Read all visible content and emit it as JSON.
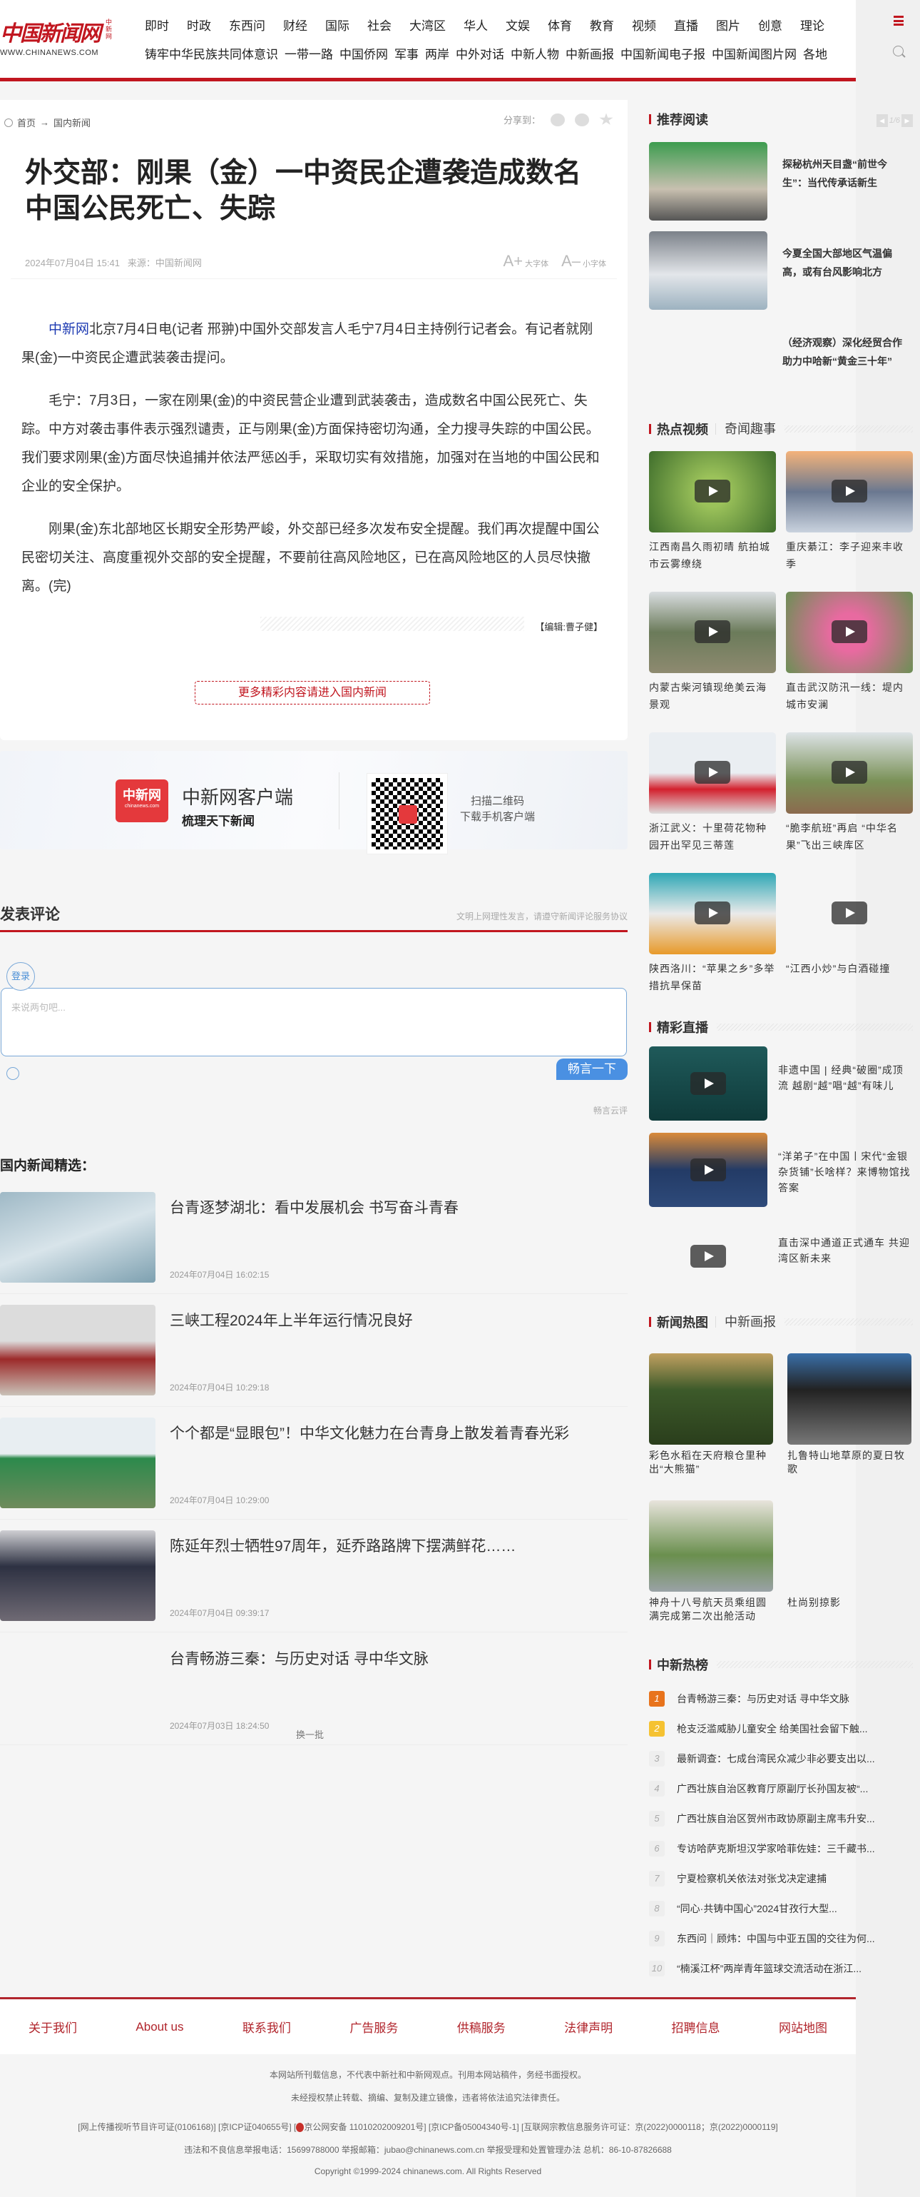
{
  "header": {
    "logo_text": "中国新闻网",
    "logo_side": "中新网",
    "logo_url": "WWW.CHINANEWS.COM",
    "nav_primary": [
      "即时",
      "时政",
      "东西问",
      "财经",
      "国际",
      "社会",
      "大湾区",
      "华人",
      "文娱",
      "体育",
      "教育",
      "视频",
      "直播",
      "图片",
      "创意",
      "理论"
    ],
    "nav_secondary": [
      "铸牢中华民族共同体意识",
      "一带一路",
      "中国侨网",
      "军事",
      "两岸",
      "中外对话",
      "中新人物",
      "中新画报",
      "中国新闻电子报",
      "中国新闻图片网",
      "各地"
    ],
    "accent_color": "#c1161f"
  },
  "breadcrumb": {
    "home": "首页",
    "arrow": "→",
    "section": "国内新闻"
  },
  "share": {
    "label": "分享到："
  },
  "article": {
    "title": "外交部：刚果（金）一中资民企遭袭造成数名中国公民死亡、失踪",
    "date": "2024年07月04日 15:41",
    "source": "来源：中国新闻网",
    "font_large": "大字体",
    "font_small": "小字体",
    "lead_link": "中新网",
    "paragraphs": [
      "北京7月4日电(记者 邢翀)中国外交部发言人毛宁7月4日主持例行记者会。有记者就刚果(金)一中资民企遭武装袭击提问。",
      "毛宁：7月3日，一家在刚果(金)的中资民营企业遭到武装袭击，造成数名中国公民死亡、失踪。中方对袭击事件表示强烈谴责，正与刚果(金)方面保持密切沟通，全力搜寻失踪的中国公民。我们要求刚果(金)方面尽快追捕并依法严惩凶手，采取切实有效措施，加强对在当地的中国公民和企业的安全保护。",
      "刚果(金)东北部地区长期安全形势严峻，外交部已经多次发布安全提醒。我们再次提醒中国公民密切关注、高度重视外交部的安全提醒，不要前往高风险地区，已在高风险地区的人员尽快撤离。(完)"
    ],
    "editor": "【编辑:曹子健】",
    "more_button": "更多精彩内容请进入国内新闻"
  },
  "app_banner": {
    "logo_text": "中新网",
    "logo_url": "chinanews.com",
    "name": "中新网客户端",
    "slogan": "梳理天下新闻",
    "scan_line1": "扫描二维码",
    "scan_line2": "下载手机客户端"
  },
  "comments": {
    "title": "发表评论",
    "note": "文明上网理性发言，请遵守新闻评论服务协议",
    "login": "登录",
    "placeholder": "来说两句吧...",
    "submit": "畅言一下",
    "provider": "畅言云评"
  },
  "selection": {
    "title": "国内新闻精选：",
    "items": [
      {
        "title": "台青逐梦湖北：看中发展机会 书写奋斗青春",
        "time": "2024年07月04日 16:02:15"
      },
      {
        "title": "三峡工程2024年上半年运行情况良好",
        "time": "2024年07月04日 10:29:18"
      },
      {
        "title": "个个都是“显眼包”！中华文化魅力在台青身上散发着青春光彩",
        "time": "2024年07月04日 10:29:00"
      },
      {
        "title": "陈延年烈士牺牲97周年，延乔路路牌下摆满鲜花……",
        "time": "2024年07月04日 09:39:17"
      },
      {
        "title": "台青畅游三秦：与历史对话 寻中华文脉",
        "time": "2024年07月03日 18:24:50"
      }
    ],
    "swap": "换一批"
  },
  "sidebar": {
    "recommend": {
      "title": "推荐阅读",
      "pager": "1/6",
      "items": [
        {
          "title": "探秘杭州天目盏“前世今生”：当代传承话新生"
        },
        {
          "title": "今夏全国大部地区气温偏高，或有台风影响北方"
        },
        {
          "title": "（经济观察）深化经贸合作助力中哈新“黄金三十年”"
        }
      ]
    },
    "videos": {
      "title": "热点视频",
      "alt_tab": "奇闻趣事",
      "items": [
        {
          "title": "江西南昌久雨初晴 航拍城市云雾缭绕"
        },
        {
          "title": "重庆綦江：李子迎来丰收季"
        },
        {
          "title": "内蒙古柴河镇现绝美云海景观"
        },
        {
          "title": "直击武汉防汛一线：堤内城市安澜"
        },
        {
          "title": "浙江武义：十里荷花物种园开出罕见三蒂莲"
        },
        {
          "title": "“脆李航班”再启 “中华名果”飞出三峡库区"
        },
        {
          "title": "陕西洛川：“苹果之乡”多举措抗旱保苗"
        },
        {
          "title": "“江西小炒”与白酒碰撞"
        }
      ]
    },
    "live": {
      "title": "精彩直播",
      "items": [
        {
          "title": "非遗中国 | 经典“破圈”成顶流 越剧“越”唱“越”有味儿"
        },
        {
          "title": "“洋弟子”在中国丨宋代“金银杂货铺”长啥样？来博物馆找答案"
        },
        {
          "title": "直击深中通道正式通车 共迎湾区新未来"
        }
      ]
    },
    "photos": {
      "title": "新闻热图",
      "alt_tab": "中新画报",
      "items": [
        {
          "title": "彩色水稻在天府粮仓里种出“大熊猫”"
        },
        {
          "title": "扎鲁特山地草原的夏日牧歌"
        },
        {
          "title": "神舟十八号航天员乘组圆满完成第二次出舱活动"
        },
        {
          "title": "杜尚别掠影"
        }
      ]
    },
    "hot": {
      "title": "中新热榜",
      "items": [
        {
          "rank": "1",
          "title": "台青畅游三秦：与历史对话 寻中华文脉"
        },
        {
          "rank": "2",
          "title": "枪支泛滥威胁儿童安全 给美国社会留下触..."
        },
        {
          "rank": "3",
          "title": "最新调查：七成台湾民众减少非必要支出以..."
        },
        {
          "rank": "4",
          "title": "广西壮族自治区教育厅原副厅长孙国友被“..."
        },
        {
          "rank": "5",
          "title": "广西壮族自治区贺州市政协原副主席韦升安..."
        },
        {
          "rank": "6",
          "title": "专访哈萨克斯坦汉学家哈菲佐娃：三千藏书..."
        },
        {
          "rank": "7",
          "title": "宁夏检察机关依法对张戈决定逮捕"
        },
        {
          "rank": "8",
          "title": "“同心·共铸中国心”2024甘孜行大型..."
        },
        {
          "rank": "9",
          "title": "东西问｜顾炜：中国与中亚五国的交往为何..."
        },
        {
          "rank": "10",
          "title": "“楠溪江杯”两岸青年篮球交流活动在浙江..."
        }
      ]
    }
  },
  "footer": {
    "links": [
      "关于我们",
      "About us",
      "联系我们",
      "广告服务",
      "供稿服务",
      "法律声明",
      "招聘信息",
      "网站地图"
    ],
    "disclaimer1": "本网站所刊载信息，不代表中新社和中新网观点。刊用本网站稿件，务经书面授权。",
    "disclaimer2": "未经授权禁止转载、摘编、复制及建立镜像，违者将依法追究法律责任。",
    "license_a": "[网上传播视听节目许可证(0106168)] [京ICP证040655号] [",
    "license_b": "京公网安备 11010202009201号] [京ICP备05004340号-1] [互联网宗教信息服务许可证：京(2022)0000118；京(2022)0000119]",
    "report": "违法和不良信息举报电话：15699788000 举报邮箱：jubao@chinanews.com.cn 举报受理和处置管理办法 总机：86-10-87826688",
    "copyright": "Copyright ©1999-2024 chinanews.com. All Rights Reserved"
  }
}
